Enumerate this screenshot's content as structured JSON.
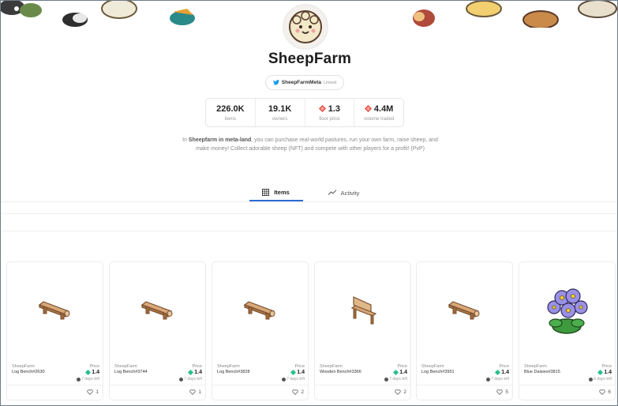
{
  "collection": {
    "title": "SheepFarm",
    "social_handle": "SheepFarmMeta",
    "social_status": "Linked"
  },
  "stats": [
    {
      "value": "226.0K",
      "label": "items",
      "icon": ""
    },
    {
      "value": "19.1K",
      "label": "owners",
      "icon": ""
    },
    {
      "value": "1.3",
      "label": "floor price",
      "icon": "token-icon"
    },
    {
      "value": "4.4M",
      "label": "volume traded",
      "icon": "token-icon"
    }
  ],
  "description": {
    "part1": "In ",
    "bold1": "Sheepfarm in meta-land",
    "part2": ", you can purchase real-world pastures, run your own farm, raise sheep, and make money! Collect adorable sheep (NFT) and compete with other players for a profit! (PvP)"
  },
  "tabs": [
    {
      "label": "Items",
      "icon": "grid-icon",
      "active": true
    },
    {
      "label": "Activity",
      "icon": "activity-icon",
      "active": false
    }
  ],
  "items": [
    {
      "collection": "SheepFarm",
      "name": "Log Bench#2630",
      "price_label": "Price",
      "price": "1.4",
      "time_left": "7 days left",
      "likes": "1",
      "art": "log-bench"
    },
    {
      "collection": "SheepFarm",
      "name": "Log Bench#3744",
      "price_label": "Price",
      "price": "1.4",
      "time_left": "7 days left",
      "likes": "1",
      "art": "log-bench"
    },
    {
      "collection": "SheepFarm",
      "name": "Log Bench#3828",
      "price_label": "Price",
      "price": "1.4",
      "time_left": "7 days left",
      "likes": "2",
      "art": "log-bench"
    },
    {
      "collection": "SheepFarm",
      "name": "Wooden Bench#3366",
      "price_label": "Price",
      "price": "1.4",
      "time_left": "7 days left",
      "likes": "2",
      "art": "wooden-bench"
    },
    {
      "collection": "SheepFarm",
      "name": "Log Bench#3951",
      "price_label": "Price",
      "price": "1.4",
      "time_left": "7 days left",
      "likes": "5",
      "art": "log-bench"
    },
    {
      "collection": "SheepFarm",
      "name": "Blue Daisies#3815",
      "price_label": "Price",
      "price": "1.4",
      "time_left": "6 days left",
      "likes": "6",
      "art": "blue-daisies"
    }
  ],
  "colors": {
    "accent": "#2c6cd6",
    "price_token": "#28c08a",
    "floor_token": "#e0463a"
  }
}
